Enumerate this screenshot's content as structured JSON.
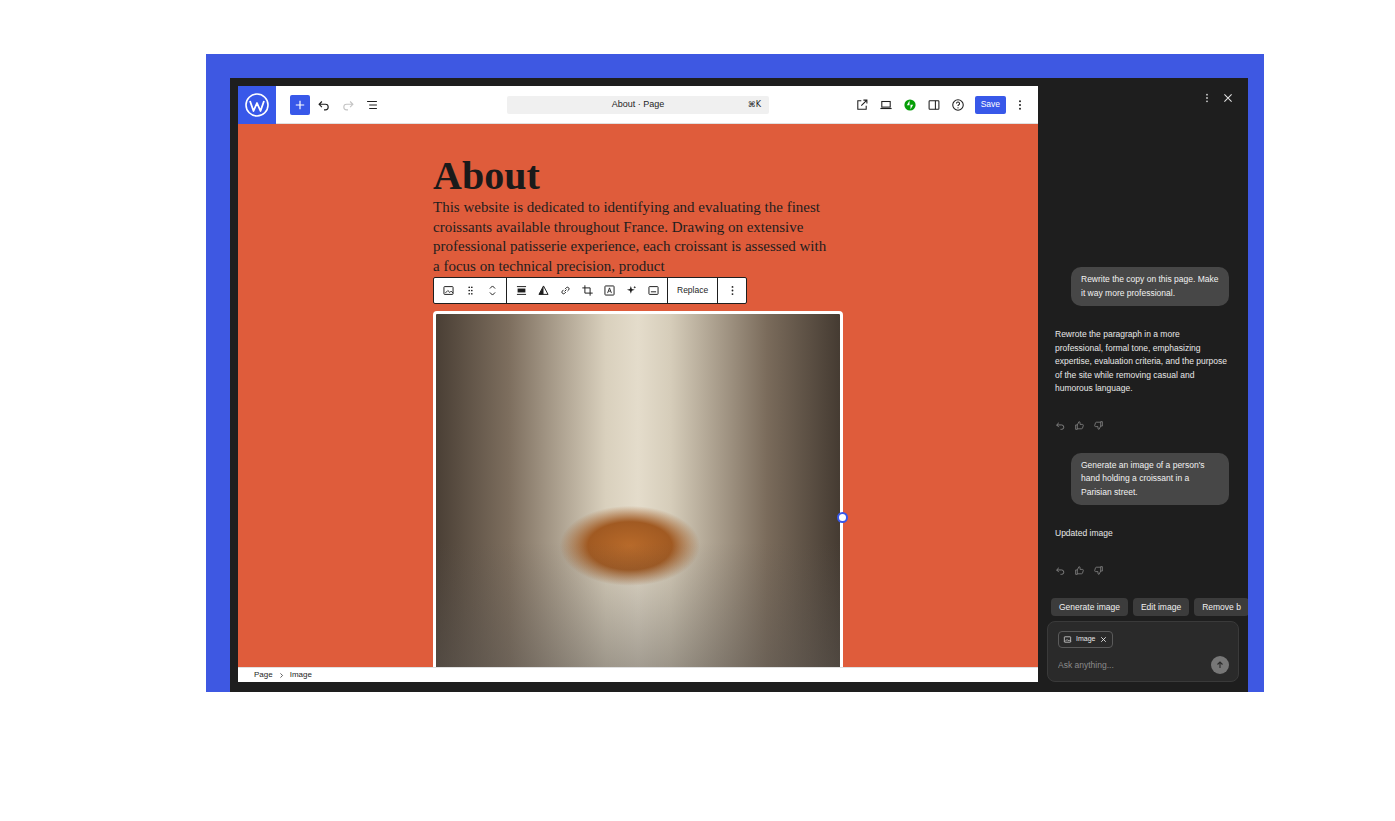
{
  "editor": {
    "title_bar": {
      "document": "About · Page",
      "shortcut": "⌘K",
      "save": "Save",
      "undo_disabled": false,
      "redo_disabled": true
    },
    "canvas": {
      "title": "About",
      "paragraph": "This website is dedicated to identifying and evaluating the finest croissants available throughout France. Drawing on extensive professional patisserie experience, each croissant is assessed with a focus on technical precision, product"
    },
    "block_toolbar": {
      "replace": "Replace"
    },
    "image": {
      "selected": true
    },
    "breadcrumb": [
      "Page",
      "Image"
    ]
  },
  "assistant": {
    "messages": [
      {
        "kind": "user",
        "text": "Rewrite the copy on this page. Make it way more professional."
      },
      {
        "kind": "assistant",
        "text": "Rewrote the paragraph in a more professional, formal tone, emphasizing expertise, evaluation criteria, and the purpose of the site while removing casual and humorous language."
      },
      {
        "kind": "user",
        "text": "Generate an image of a person's hand holding a croissant in a Parisian street."
      },
      {
        "kind": "assistant",
        "text": "Updated image"
      }
    ],
    "suggestions": [
      "Generate image",
      "Edit image",
      "Remove b"
    ],
    "composer": {
      "attachment": "Image",
      "placeholder": "Ask anything..."
    }
  }
}
